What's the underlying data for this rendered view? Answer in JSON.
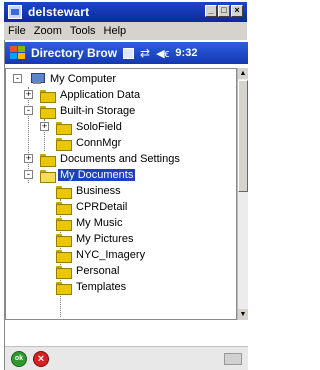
{
  "window": {
    "title": "delstewart",
    "controls": [
      "_",
      "□",
      "×"
    ]
  },
  "menu": [
    "File",
    "Zoom",
    "Tools",
    "Help"
  ],
  "device": {
    "title": "Directory Brow",
    "time": "9:32"
  },
  "tree": {
    "nodes": [
      {
        "label": "My Computer",
        "expander": "-"
      },
      {
        "label": "Application Data",
        "expander": "+"
      },
      {
        "label": "Built-in Storage",
        "expander": "-"
      },
      {
        "label": "SoloField",
        "expander": "+"
      },
      {
        "label": "ConnMgr",
        "expander": ""
      },
      {
        "label": "Documents and Settings",
        "expander": "+"
      },
      {
        "label": "My Documents",
        "expander": "-",
        "selected": true
      },
      {
        "label": "Business",
        "expander": ""
      },
      {
        "label": "CPRDetail",
        "expander": ""
      },
      {
        "label": "My Music",
        "expander": ""
      },
      {
        "label": "My Pictures",
        "expander": ""
      },
      {
        "label": "NYC_Imagery",
        "expander": ""
      },
      {
        "label": "Personal",
        "expander": ""
      },
      {
        "label": "Templates",
        "expander": ""
      }
    ]
  },
  "bottombar": {
    "ok_label": "ok",
    "close_label": "×"
  }
}
